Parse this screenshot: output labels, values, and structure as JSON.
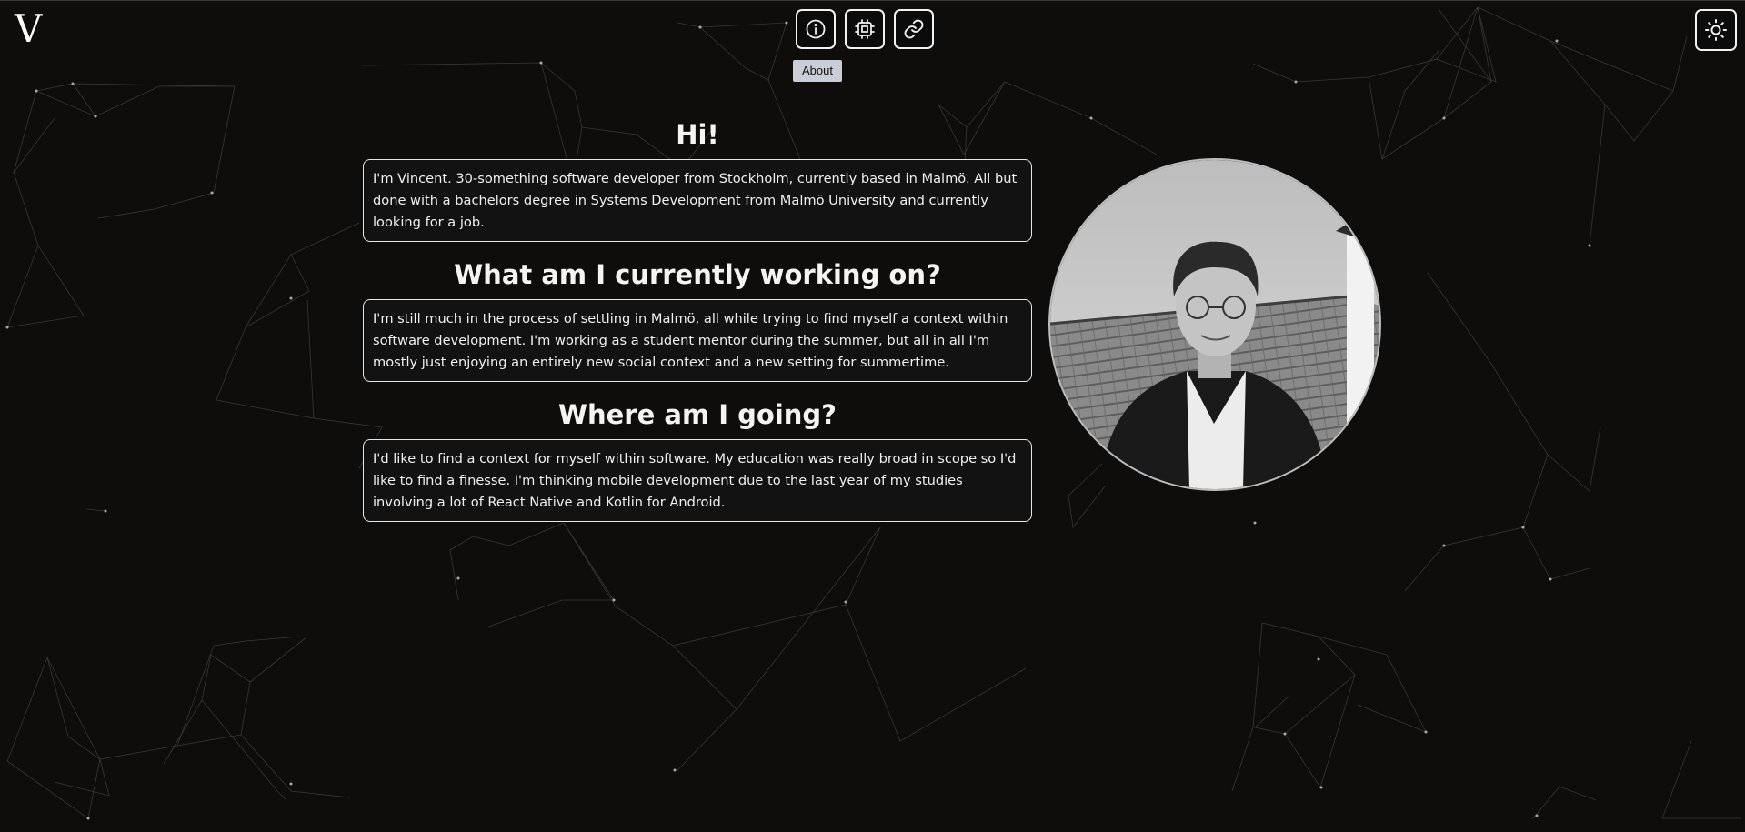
{
  "header": {
    "logo_text": "V",
    "nav": [
      {
        "id": "about",
        "icon": "info-icon"
      },
      {
        "id": "projects",
        "icon": "chip-icon"
      },
      {
        "id": "links",
        "icon": "link-icon"
      }
    ],
    "tooltip": "About",
    "theme_toggle_icon": "sun-icon"
  },
  "sections": [
    {
      "heading": "Hi!",
      "body": "I'm Vincent. 30-something software developer from Stockholm, currently based in Malmö. All but done with a bachelors degree in Systems Development from Malmö University and currently looking for a job."
    },
    {
      "heading": "What am I currently working on?",
      "body": "I'm still much in the process of settling in Malmö, all while trying to find myself a context within software development. I'm working as a student mentor during the summer, but all in all I'm mostly just enjoying an entirely new social context and a new setting for summertime."
    },
    {
      "heading": "Where am I going?",
      "body": "I'd like to find a context for myself within software. My education was really broad in scope so I'd like to find a finesse. I'm thinking mobile development due to the last year of my studies involving a lot of React Native and Kotlin for Android."
    }
  ],
  "colors": {
    "background": "#0f0d0b",
    "text": "#f2f2f2",
    "border": "#e6e6e6",
    "tooltip_bg": "#c9cdd6"
  }
}
